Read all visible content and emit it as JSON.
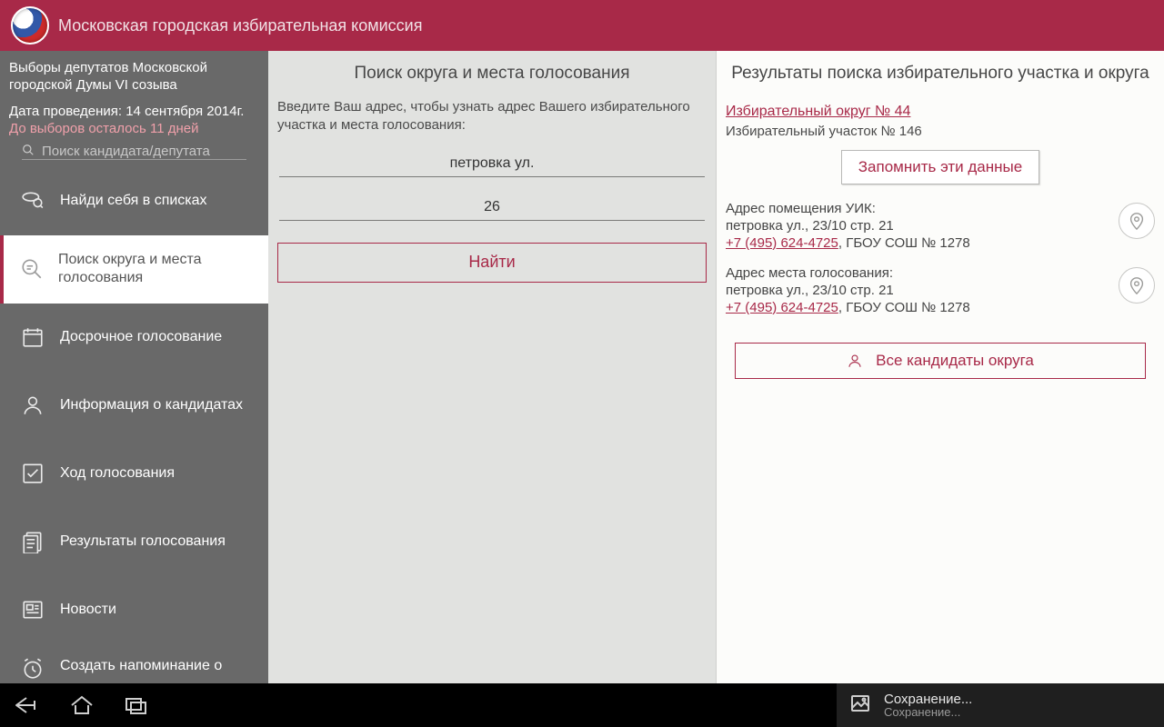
{
  "appbar": {
    "title": "Московская городская избирательная комиссия"
  },
  "sidebar": {
    "election_info": "Выборы депутатов Московской городской Думы VI созыва",
    "date_line": "Дата проведения: 14 сентября 2014г.",
    "countdown": "До выборов осталось 11 дней",
    "search_placeholder": "Поиск кандидата/депутата",
    "items": [
      {
        "label": "Найди себя в списках"
      },
      {
        "label": "Поиск округа и места голосования"
      },
      {
        "label": "Досрочное голосование"
      },
      {
        "label": "Информация о кандидатах"
      },
      {
        "label": "Ход голосования"
      },
      {
        "label": "Результаты голосования"
      },
      {
        "label": "Новости"
      },
      {
        "label": "Создать напоминание о"
      }
    ]
  },
  "center": {
    "title": "Поиск округа и места голосования",
    "hint": "Введите Ваш адрес, чтобы узнать адрес Вашего избирательного участка и места голосования:",
    "street_value": "петровка ул.",
    "house_value": "26",
    "find_label": "Найти"
  },
  "right": {
    "title": "Результаты поиска избирательного участка и округа",
    "district_link": "Избирательный округ № 44",
    "station_text": "Избирательный участок № 146",
    "remember_label": "Запомнить эти данные",
    "uik": {
      "label": "Адрес помещения УИК:",
      "addr": "петровка ул., 23/10 стр. 21",
      "phone": "+7 (495) 624-4725",
      "school": ", ГБОУ СОШ № 1278"
    },
    "vote": {
      "label": "Адрес места голосования:",
      "addr": "петровка ул., 23/10 стр. 21",
      "phone": "+7 (495) 624-4725",
      "school": ", ГБОУ СОШ № 1278"
    },
    "candidates_label": "Все кандидаты округа"
  },
  "sysbar": {
    "notif_title": "Сохранение...",
    "notif_sub": "Сохранение..."
  }
}
